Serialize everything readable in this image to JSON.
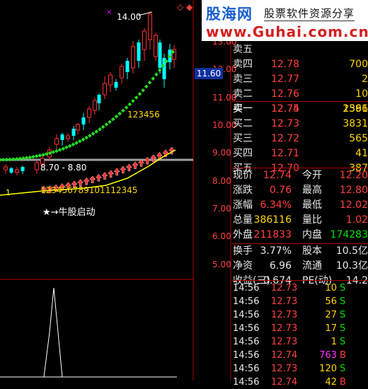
{
  "banner": {
    "brand": "股海网",
    "slogan": "股票软件资源分享",
    "url": "www.Guhai.com.cn"
  },
  "chart": {
    "peak_label": "14.00",
    "range_label": "8.70 - 8.80",
    "count_label_1": "123456",
    "count_label_2": "123456789101112345",
    "legend": "★→牛股启动",
    "current_price_tag": "11.60",
    "y_ticks": [
      "13.00",
      "12.00",
      "11.00",
      "10.00",
      "9.00",
      "8.00",
      "7.00",
      "6.00",
      "5.00"
    ],
    "colors": {
      "rise": "#ff3030",
      "fall": "#00ffff",
      "dots": "#22dd22",
      "arrows": "#ff3030",
      "yellow_line": "#ffff00"
    }
  },
  "quote": {
    "asks": [
      {
        "label": "卖五",
        "price": "",
        "vol": ""
      },
      {
        "label": "卖四",
        "price": "12.78",
        "vol": "700"
      },
      {
        "label": "卖三",
        "price": "12.77",
        "vol": "2"
      },
      {
        "label": "卖二",
        "price": "12.76",
        "vol": "10"
      },
      {
        "label": "卖一",
        "price": "12.75",
        "vol": "1366"
      }
    ],
    "bids": [
      {
        "label": "买一",
        "price": "12.74",
        "vol": "2591"
      },
      {
        "label": "买二",
        "price": "12.73",
        "vol": "3831"
      },
      {
        "label": "买三",
        "price": "12.72",
        "vol": "565"
      },
      {
        "label": "买四",
        "price": "12.71",
        "vol": "41"
      },
      {
        "label": "买五",
        "price": "12.70",
        "vol": "387"
      }
    ],
    "stats": [
      {
        "l1": "现价",
        "v1": "12.74",
        "c1": "red",
        "l2": "今开",
        "v2": "12.20",
        "c2": "red"
      },
      {
        "l1": "涨跌",
        "v1": "0.76",
        "c1": "red",
        "l2": "最高",
        "v2": "12.80",
        "c2": "red"
      },
      {
        "l1": "涨幅",
        "v1": "6.34%",
        "c1": "red",
        "l2": "最低",
        "v2": "12.02",
        "c2": "red"
      },
      {
        "l1": "总量",
        "v1": "386116",
        "c1": "yel",
        "l2": "量比",
        "v2": "1.02",
        "c2": "red"
      },
      {
        "l1": "外盘",
        "v1": "211833",
        "c1": "red",
        "l2": "内盘",
        "v2": "174283",
        "c2": "grn"
      },
      {
        "l1": "换手",
        "v1": "3.77%",
        "c1": "wht",
        "l2": "股本",
        "v2": "10.5亿",
        "c2": "wht"
      },
      {
        "l1": "净资",
        "v1": "6.96",
        "c1": "wht",
        "l2": "流通",
        "v2": "10.3亿",
        "c2": "wht"
      },
      {
        "l1": "收益(三)",
        "v1": "0.674",
        "c1": "wht",
        "l2": "PE(动)",
        "v2": "14.2",
        "c2": "wht"
      }
    ],
    "ticks": [
      {
        "time": "14:56",
        "price": "12.73",
        "vol": "10",
        "vc": "yel",
        "side": "S",
        "sc": "grn"
      },
      {
        "time": "14:56",
        "price": "12.73",
        "vol": "56",
        "vc": "yel",
        "side": "S",
        "sc": "grn"
      },
      {
        "time": "14:56",
        "price": "12.73",
        "vol": "27",
        "vc": "yel",
        "side": "S",
        "sc": "grn"
      },
      {
        "time": "14:56",
        "price": "12.73",
        "vol": "17",
        "vc": "yel",
        "side": "S",
        "sc": "grn"
      },
      {
        "time": "14:56",
        "price": "12.73",
        "vol": "1",
        "vc": "yel",
        "side": "S",
        "sc": "grn"
      },
      {
        "time": "14:56",
        "price": "12.74",
        "vol": "763",
        "vc": "mag",
        "side": "B",
        "sc": "red"
      },
      {
        "time": "14:56",
        "price": "12.73",
        "vol": "120",
        "vc": "yel",
        "side": "S",
        "sc": "grn"
      },
      {
        "time": "14:56",
        "price": "12.74",
        "vol": "42",
        "vc": "yel",
        "side": "B",
        "sc": "red"
      }
    ]
  }
}
